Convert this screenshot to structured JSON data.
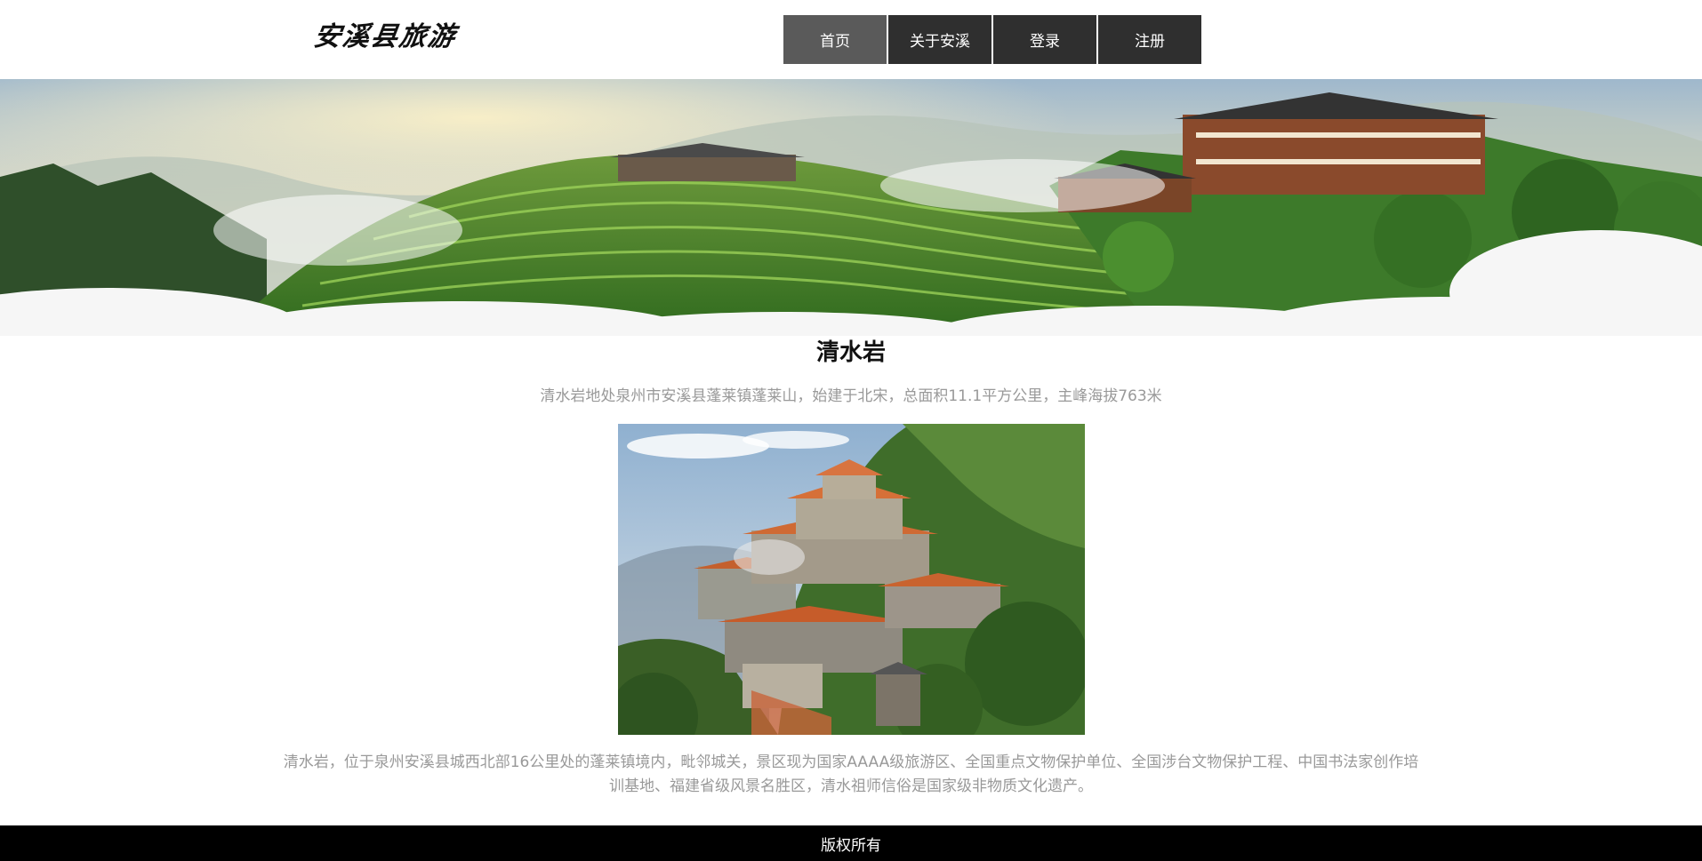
{
  "header": {
    "logo_text": "安溪县旅游"
  },
  "nav": {
    "items": [
      {
        "label": "首页",
        "active": true
      },
      {
        "label": "关于安溪",
        "active": false
      },
      {
        "label": "登录",
        "active": false
      },
      {
        "label": "注册",
        "active": false
      }
    ]
  },
  "main": {
    "title": "清水岩",
    "subtitle": "清水岩地处泉州市安溪县蓬莱镇蓬莱山，始建于北宋，总面积11.1平方公里，主峰海拔763米",
    "description": "清水岩，位于泉州安溪县城西北部16公里处的蓬莱镇境内，毗邻城关，景区现为国家AAAA级旅游区、全国重点文物保护单位、全国涉台文物保护工程、中国书法家创作培训基地、福建省级风景名胜区，清水祖师信俗是国家级非物质文化遗产。"
  },
  "footer": {
    "text": "版权所有"
  },
  "colors": {
    "nav_bg": "#2f2f2f",
    "nav_active_bg": "#5a5a5a",
    "footer_bg": "#000000",
    "muted_text": "#999999"
  }
}
